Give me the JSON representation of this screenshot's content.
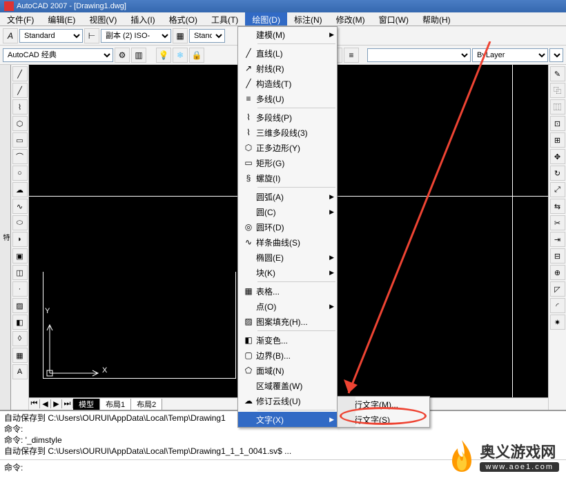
{
  "title": "AutoCAD 2007 - [Drawing1.dwg]",
  "menubar": {
    "items": [
      {
        "label": "文件(F)"
      },
      {
        "label": "编辑(E)"
      },
      {
        "label": "视图(V)"
      },
      {
        "label": "插入(I)"
      },
      {
        "label": "格式(O)"
      },
      {
        "label": "工具(T)"
      },
      {
        "label": "绘图(D)",
        "active": true
      },
      {
        "label": "标注(N)"
      },
      {
        "label": "修改(M)"
      },
      {
        "label": "窗口(W)"
      },
      {
        "label": "帮助(H)"
      }
    ]
  },
  "toolbar1": {
    "style_select": "Standard",
    "dim_select": "副本 (2) ISO-",
    "table_select": "Standar"
  },
  "toolbar2": {
    "workspace_select": "AutoCAD 经典",
    "layer_select": "ByLayer"
  },
  "draw_menu": [
    {
      "label": "建模(M)",
      "sub": true
    },
    {
      "sep": true
    },
    {
      "icon": "line",
      "label": "直线(L)"
    },
    {
      "icon": "ray",
      "label": "射线(R)"
    },
    {
      "icon": "xline",
      "label": "构造线(T)"
    },
    {
      "icon": "mline",
      "label": "多线(U)"
    },
    {
      "sep": true
    },
    {
      "icon": "pline",
      "label": "多段线(P)"
    },
    {
      "icon": "3dpoly",
      "label": "三维多段线(3)"
    },
    {
      "icon": "polygon",
      "label": "正多边形(Y)"
    },
    {
      "icon": "rect",
      "label": "矩形(G)"
    },
    {
      "icon": "helix",
      "label": "螺旋(I)"
    },
    {
      "sep": true
    },
    {
      "label": "圆弧(A)",
      "sub": true
    },
    {
      "label": "圆(C)",
      "sub": true
    },
    {
      "icon": "donut",
      "label": "圆环(D)"
    },
    {
      "icon": "spline",
      "label": "样条曲线(S)"
    },
    {
      "label": "椭圆(E)",
      "sub": true
    },
    {
      "label": "块(K)",
      "sub": true
    },
    {
      "sep": true
    },
    {
      "icon": "table",
      "label": "表格..."
    },
    {
      "label": "点(O)",
      "sub": true
    },
    {
      "icon": "hatch",
      "label": "图案填充(H)..."
    },
    {
      "sep": true
    },
    {
      "icon": "gradient",
      "label": "渐变色..."
    },
    {
      "icon": "boundary",
      "label": "边界(B)..."
    },
    {
      "icon": "region",
      "label": "面域(N)"
    },
    {
      "label": "区域覆盖(W)"
    },
    {
      "icon": "revcloud",
      "label": "修订云线(U)"
    },
    {
      "sep": true
    },
    {
      "label": "文字(X)",
      "sub": true,
      "hl": true
    }
  ],
  "text_submenu": [
    {
      "icon": "A",
      "label": "多行文字(M)..."
    },
    {
      "icon": "A",
      "label": "单行文字(S)"
    }
  ],
  "layout_tabs": {
    "tabs": [
      "模型",
      "布局1",
      "布局2"
    ],
    "active": 0
  },
  "ucs": {
    "x": "X",
    "y": "Y"
  },
  "cmd": {
    "lines": [
      "自动保存到 C:\\Users\\OURUI\\AppData\\Local\\Temp\\Drawing1",
      "命令:",
      "命令: '_dimstyle",
      "自动保存到 C:\\Users\\OURUI\\AppData\\Local\\Temp\\Drawing1_1_1_0041.sv$ ..."
    ],
    "prompt": "命令:"
  },
  "watermark": {
    "cn": "奥义游戏网",
    "url": "www.aoe1.com"
  }
}
